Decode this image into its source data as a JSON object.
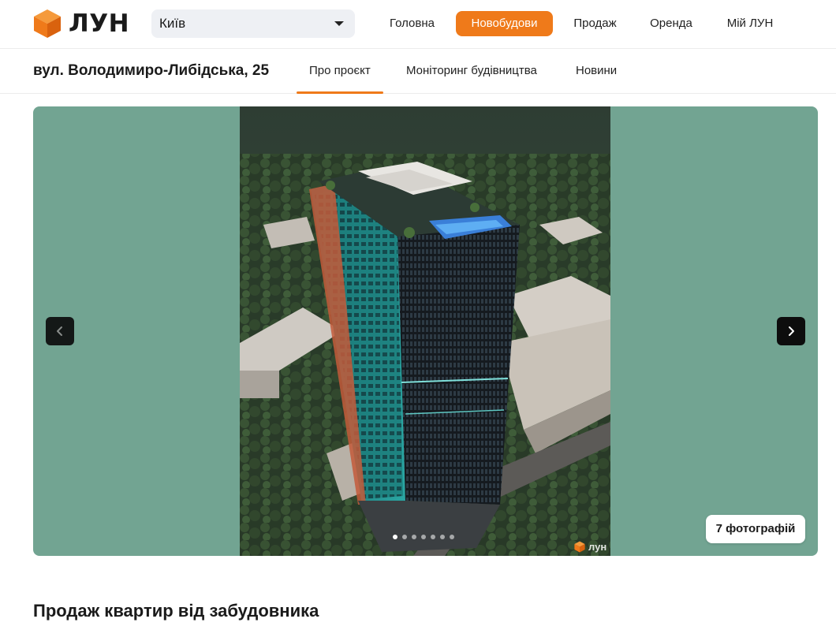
{
  "header": {
    "logo_text": "ЛУН",
    "city_select": {
      "value": "Київ"
    },
    "nav": [
      {
        "label": "Головна",
        "active": false
      },
      {
        "label": "Новобудови",
        "active": true
      },
      {
        "label": "Продаж",
        "active": false
      },
      {
        "label": "Оренда",
        "active": false
      },
      {
        "label": "Мій ЛУН",
        "active": false
      }
    ]
  },
  "project": {
    "address": "вул. Володимиро-Либідська, 25",
    "tabs": [
      {
        "label": "Про проєкт",
        "active": true
      },
      {
        "label": "Моніторинг будівництва",
        "active": false
      },
      {
        "label": "Новини",
        "active": false
      }
    ]
  },
  "gallery": {
    "photo_count_label": "7 фотографій",
    "total_photos": 7,
    "current_index": 1,
    "watermark_text": "лун",
    "background_color": "#72a492"
  },
  "sections": {
    "sales_title": "Продаж квартир від забудовника"
  },
  "colors": {
    "accent": "#ef7a1a",
    "logo_front": "#ef7a1a",
    "logo_top": "#f59a3c",
    "logo_side": "#d9620e"
  },
  "icons": {
    "logo": "orange-cube-logo",
    "city_dropdown": "caret-down-icon",
    "prev": "chevron-left-icon",
    "next": "chevron-right-icon"
  }
}
